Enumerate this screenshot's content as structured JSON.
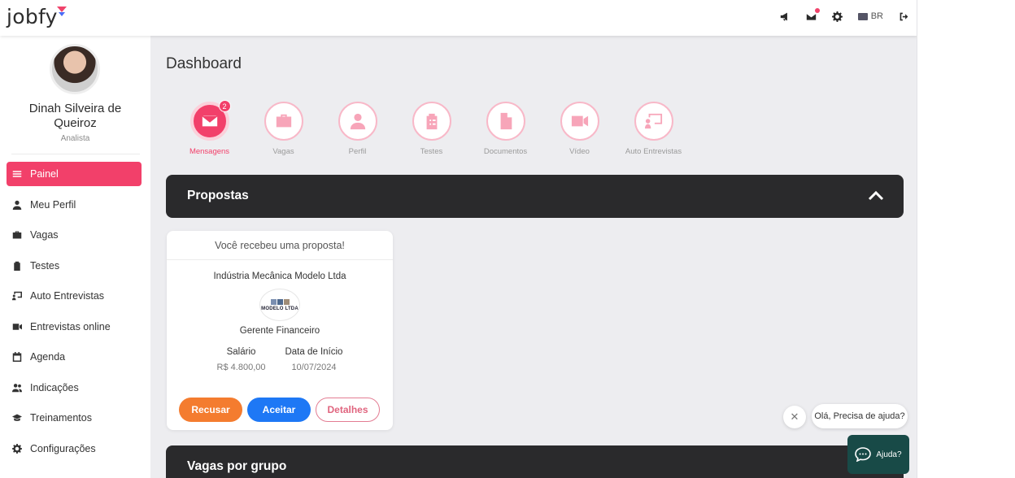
{
  "app": {
    "logo": "jobfy",
    "language": "BR"
  },
  "user": {
    "name": "Dinah Silveira de Queiroz",
    "role": "Analista"
  },
  "sidebar": {
    "items": [
      {
        "label": "Painel",
        "icon": "menu-icon",
        "active": true
      },
      {
        "label": "Meu Perfil",
        "icon": "user-icon"
      },
      {
        "label": "Vagas",
        "icon": "briefcase-icon"
      },
      {
        "label": "Testes",
        "icon": "clipboard-icon"
      },
      {
        "label": "Auto Entrevistas",
        "icon": "presentation-icon"
      },
      {
        "label": "Entrevistas online",
        "icon": "video-icon"
      },
      {
        "label": "Agenda",
        "icon": "calendar-icon"
      },
      {
        "label": "Indicações",
        "icon": "users-icon"
      },
      {
        "label": "Treinamentos",
        "icon": "graduation-cap-icon"
      },
      {
        "label": "Configurações",
        "icon": "gear-icon"
      }
    ]
  },
  "dashboard": {
    "title": "Dashboard",
    "quick_links": [
      {
        "label": "Mensagens",
        "icon": "envelope-icon",
        "badge": "2",
        "active": true
      },
      {
        "label": "Vagas",
        "icon": "briefcase-icon"
      },
      {
        "label": "Perfil",
        "icon": "user-icon"
      },
      {
        "label": "Testes",
        "icon": "clipboard-icon"
      },
      {
        "label": "Documentos",
        "icon": "document-icon"
      },
      {
        "label": "Vídeo",
        "icon": "video-icon"
      },
      {
        "label": "Auto Entrevistas",
        "icon": "presentation-icon"
      }
    ]
  },
  "proposals": {
    "header": "Propostas",
    "card": {
      "heading": "Você recebeu uma proposta!",
      "company": "Indústria Mecânica Modelo Ltda",
      "company_logo_text": "MODELO LTDA",
      "job_title": "Gerente Financeiro",
      "salary_label": "Salário",
      "salary_value": "R$ 4.800,00",
      "start_label": "Data de Início",
      "start_value": "10/07/2024",
      "reject_label": "Recusar",
      "accept_label": "Aceitar",
      "details_label": "Detalhes"
    }
  },
  "groups": {
    "header": "Vagas por grupo"
  },
  "help": {
    "bubble": "Olá, Precisa de ajuda?",
    "button_label": "Ajuda?"
  },
  "colors": {
    "accent": "#f2406a",
    "panel_dark": "#2a2a2c",
    "reject": "#f47c2f",
    "accept": "#1e78f5",
    "help": "#184a47"
  }
}
